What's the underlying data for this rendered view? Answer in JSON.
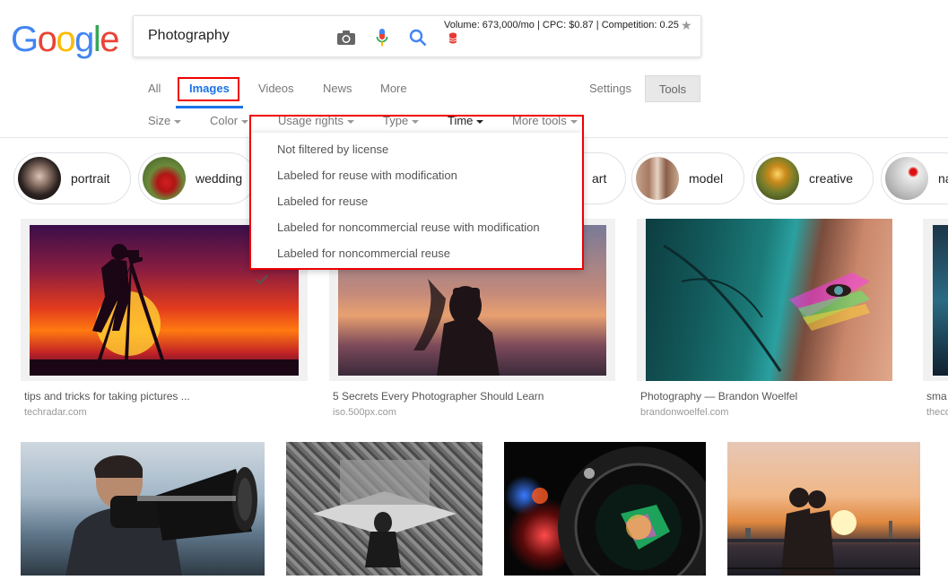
{
  "logo": {
    "letters": [
      "G",
      "o",
      "o",
      "g",
      "l",
      "e"
    ],
    "colors": [
      "#4285f4",
      "#ea4335",
      "#fbbc05",
      "#4285f4",
      "#34a853",
      "#ea4335"
    ]
  },
  "search": {
    "query": "Photography",
    "seo_stats": "Volume: 673,000/mo | CPC: $0.87 | Competition: 0.25"
  },
  "icons": {
    "camera": "camera-icon",
    "mic": "mic-icon",
    "search": "search-icon",
    "db": "database-icon",
    "star": "star-icon",
    "check": "check-icon"
  },
  "tabs": [
    {
      "label": "All"
    },
    {
      "label": "Images"
    },
    {
      "label": "Videos"
    },
    {
      "label": "News"
    },
    {
      "label": "More"
    }
  ],
  "settings_label": "Settings",
  "tools_label": "Tools",
  "filters": [
    {
      "label": "Size"
    },
    {
      "label": "Color"
    },
    {
      "label": "Usage rights"
    },
    {
      "label": "Type"
    },
    {
      "label": "Time"
    },
    {
      "label": "More tools"
    }
  ],
  "usage_rights_menu": [
    {
      "label": "Not filtered by license",
      "checked": true
    },
    {
      "label": "Labeled for reuse with modification"
    },
    {
      "label": "Labeled for reuse"
    },
    {
      "label": "Labeled for noncommercial reuse with modification"
    },
    {
      "label": "Labeled for noncommercial reuse"
    }
  ],
  "chips": [
    {
      "label": "portrait"
    },
    {
      "label": "wedding"
    },
    {
      "label": "art"
    },
    {
      "label": "model"
    },
    {
      "label": "creative"
    },
    {
      "label": "na"
    }
  ],
  "results": [
    {
      "title": "tips and tricks for taking pictures ...",
      "source": "techradar.com"
    },
    {
      "title": "5 Secrets Every Photographer Should Learn",
      "source": "iso.500px.com"
    },
    {
      "title": "Photography — Brandon Woelfel",
      "source": "brandonwoelfel.com"
    },
    {
      "title": "sma",
      "source": "theco"
    }
  ],
  "colors": {
    "accent": "#1a73e8",
    "highlight": "#e00000"
  }
}
